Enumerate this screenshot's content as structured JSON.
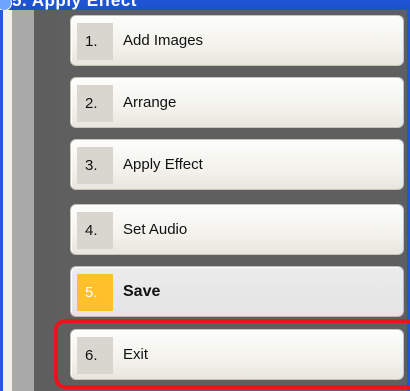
{
  "window": {
    "title_fragment": "5. Apply Effect"
  },
  "steps": [
    {
      "number": "1.",
      "label": "Add Images"
    },
    {
      "number": "2.",
      "label": "Arrange"
    },
    {
      "number": "3.",
      "label": "Apply Effect"
    },
    {
      "number": "4.",
      "label": "Set Audio"
    },
    {
      "number": "5.",
      "label": "Save",
      "active": true
    },
    {
      "number": "6.",
      "label": "Exit",
      "highlighted": true
    }
  ],
  "colors": {
    "active_number_bg": "#ffc12b",
    "highlight_border": "#e8151d",
    "title_bar": "#1d55d8"
  },
  "icons": {
    "window": "app-icon"
  }
}
